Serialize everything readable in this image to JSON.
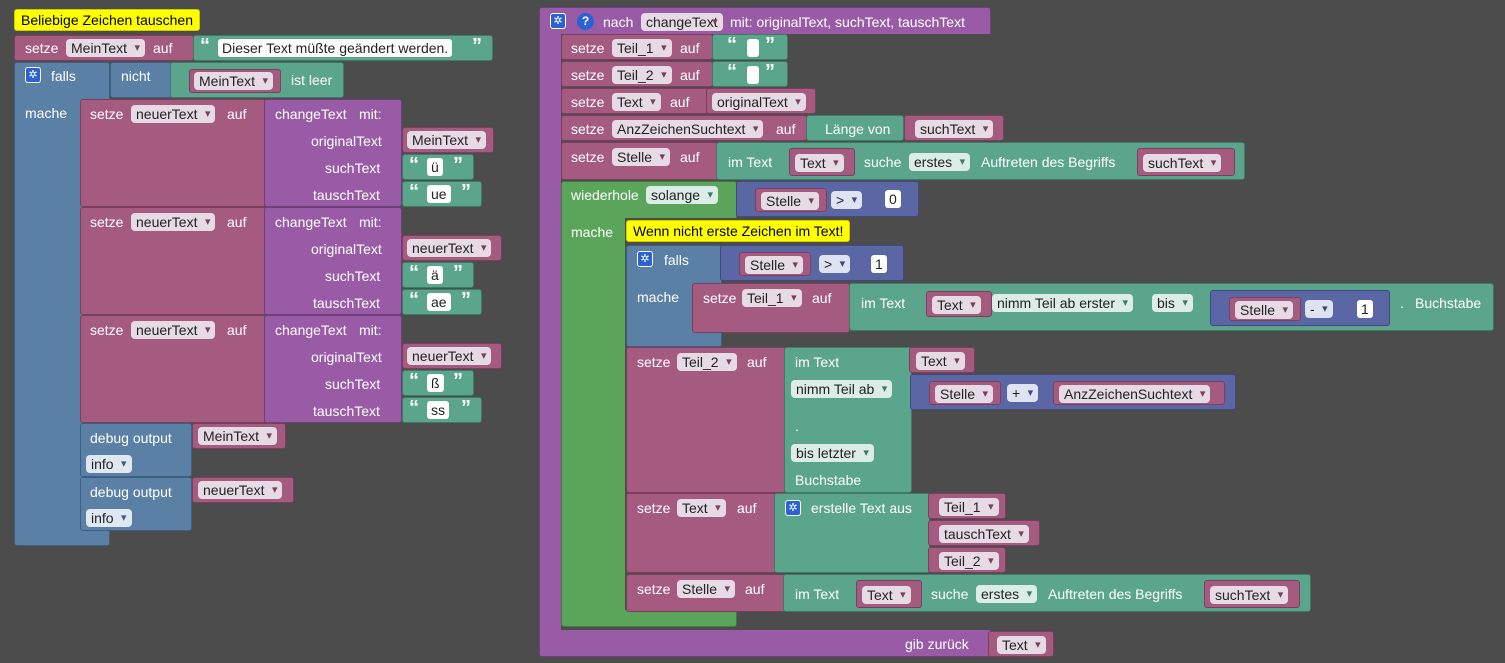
{
  "left": {
    "comment": "Beliebige Zeichen tauschen",
    "set_main": {
      "setze": "setze",
      "var": "MeinText",
      "auf": "auf",
      "value": "Dieser Text müßte geändert werden."
    },
    "if": {
      "falls": "falls",
      "nicht": "nicht",
      "var": "MeinText",
      "ist_leer": "ist leer",
      "mache": "mache",
      "calls": [
        {
          "setze": "setze",
          "var": "neuerText",
          "auf": "auf",
          "fn": "changeText",
          "mit": "mit:",
          "p1": "originalText",
          "p1v": "MeinText",
          "p2": "suchText",
          "p2v": "ü",
          "p3": "tauschText",
          "p3v": "ue"
        },
        {
          "setze": "setze",
          "var": "neuerText",
          "auf": "auf",
          "fn": "changeText",
          "mit": "mit:",
          "p1": "originalText",
          "p1v": "neuerText",
          "p2": "suchText",
          "p2v": "ä",
          "p3": "tauschText",
          "p3v": "ae"
        },
        {
          "setze": "setze",
          "var": "neuerText",
          "auf": "auf",
          "fn": "changeText",
          "mit": "mit:",
          "p1": "originalText",
          "p1v": "neuerText",
          "p2": "suchText",
          "p2v": "ß",
          "p3": "tauschText",
          "p3v": "ss"
        }
      ],
      "debug": [
        {
          "label": "debug output",
          "var": "MeinText",
          "level": "info"
        },
        {
          "label": "debug output",
          "var": "neuerText",
          "level": "info"
        }
      ]
    }
  },
  "func": {
    "nach": "nach",
    "name": "changeText",
    "params": "mit: originalText, suchText, tauschText",
    "set1": {
      "setze": "setze",
      "var": "Teil_1",
      "auf": "auf"
    },
    "set2": {
      "setze": "setze",
      "var": "Teil_2",
      "auf": "auf"
    },
    "set3": {
      "setze": "setze",
      "var": "Text",
      "auf": "auf",
      "value": "originalText"
    },
    "set4": {
      "setze": "setze",
      "var": "AnzZeichenSuchtext",
      "auf": "auf",
      "laenge": "Länge von",
      "value": "suchText"
    },
    "set5": {
      "setze": "setze",
      "var": "Stelle",
      "auf": "auf",
      "im_text": "im Text",
      "text_var": "Text",
      "suche": "suche",
      "mode": "erstes",
      "auftreten": "Auftreten des Begriffs",
      "such": "suchText"
    },
    "loop": {
      "wiederhole": "wiederhole",
      "mode": "solange",
      "var": "Stelle",
      "op": ">",
      "num": "0",
      "mache": "mache"
    },
    "comment2": "Wenn nicht erste Zeichen im Text!",
    "inner_if": {
      "falls": "falls",
      "var": "Stelle",
      "op": ">",
      "num": "1",
      "mache": "mache",
      "set": {
        "setze": "setze",
        "var": "Teil_1",
        "auf": "auf",
        "im_text": "im Text",
        "text_var": "Text",
        "nimm": "nimm Teil ab erster",
        "bis": "bis",
        "stelle": "Stelle",
        "minus": "-",
        "one": "1",
        "dot": ".",
        "buchstabe": "Buchstabe"
      }
    },
    "set_teil2": {
      "setze": "setze",
      "var": "Teil_2",
      "auf": "auf",
      "im_text": "im Text",
      "text_var": "Text",
      "nimm": "nimm Teil ab",
      "stelle": "Stelle",
      "plus": "+",
      "anz": "AnzZeichenSuchtext",
      "dot": ".",
      "bis": "bis letzter",
      "buchstabe": "Buchstabe"
    },
    "set_text": {
      "setze": "setze",
      "var": "Text",
      "auf": "auf",
      "erstelle": "erstelle Text aus",
      "items": [
        "Teil_1",
        "tauschText",
        "Teil_2"
      ]
    },
    "set_stelle": {
      "setze": "setze",
      "var": "Stelle",
      "auf": "auf",
      "im_text": "im Text",
      "text_var": "Text",
      "suche": "suche",
      "mode": "erstes",
      "auftreten": "Auftreten des Begriffs",
      "such": "suchText"
    },
    "return": {
      "label": "gib zurück",
      "var": "Text"
    }
  }
}
